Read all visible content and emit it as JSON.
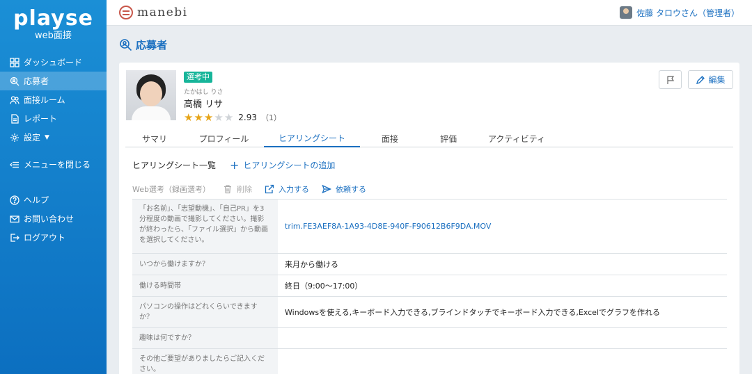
{
  "sidebar": {
    "logo": "playse",
    "subtitle": "web面接",
    "items": [
      {
        "label": "ダッシュボード"
      },
      {
        "label": "応募者"
      },
      {
        "label": "面接ルーム"
      },
      {
        "label": "レポート"
      },
      {
        "label": "設定"
      },
      {
        "label": "メニューを閉じる"
      },
      {
        "label": "ヘルプ"
      },
      {
        "label": "お問い合わせ"
      },
      {
        "label": "ログアウト"
      }
    ]
  },
  "topbar": {
    "brand": "manebi",
    "user_name": "佐藤 タロウさん（管理者）"
  },
  "page": {
    "title": "応募者"
  },
  "applicant": {
    "status": "選考中",
    "name_kana": "たかはし りさ",
    "name": "高橋 リサ",
    "rating": 2.93,
    "rating_text": "2.93",
    "rating_count": "（1）",
    "stars": [
      true,
      true,
      true,
      false,
      false
    ],
    "edit_label": "編集"
  },
  "tabs": [
    {
      "label": "サマリ"
    },
    {
      "label": "プロフィール"
    },
    {
      "label": "ヒアリングシート"
    },
    {
      "label": "面接"
    },
    {
      "label": "評価"
    },
    {
      "label": "アクティビティ"
    }
  ],
  "active_tab": "ヒアリングシート",
  "hearing": {
    "list_title": "ヒアリングシート一覧",
    "add_label": "ヒアリングシートの追加",
    "sheet_title": "Web選考（録画選考）",
    "delete_label": "削除",
    "input_label": "入力する",
    "request_label": "依頼する",
    "rows": [
      {
        "question": "「お名前」、「志望動機」、「自己PR」を3分程度の動画で撮影してください。撮影が終わったら、「ファイル選択」から動画を選択してください。",
        "answer": "trim.FE3AEF8A-1A93-4D8E-940F-F90612B6F9DA.MOV"
      },
      {
        "question": "いつから働けますか？",
        "answer": "来月から働ける"
      },
      {
        "question": "働ける時間帯",
        "answer": "終日（9:00〜17:00）"
      },
      {
        "question": "パソコンの操作はどれくらいできますか？",
        "answer": "Windowsを使える,キーボード入力できる,ブラインドタッチでキーボード入力できる,Excelでグラフを作れる"
      },
      {
        "question": "趣味は何ですか？",
        "answer": ""
      },
      {
        "question": "その他ご要望がありましたらご記入ください。",
        "answer": ""
      }
    ]
  },
  "colors": {
    "sidebar": "#1b8fd6",
    "accent": "#1a6fc0",
    "status_badge": "#17b59a",
    "star_on": "#e6a417",
    "star_off": "#cfd3d7"
  }
}
